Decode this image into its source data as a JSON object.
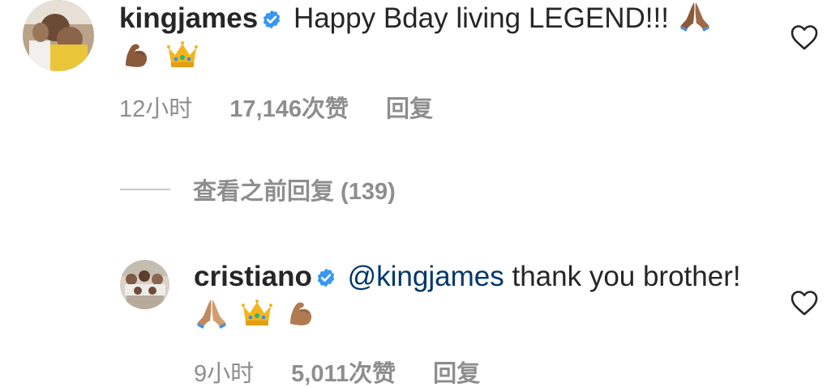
{
  "comments": [
    {
      "username": "kingjames",
      "mention": "",
      "text": "Happy Bday living LEGEND!!!",
      "emojis": [
        "folded-hands-emoji",
        "flexed-biceps-emoji",
        "crown-emoji"
      ],
      "time": "12小时",
      "likes": "17,146次赞",
      "reply_label": "回复"
    },
    {
      "username": "cristiano",
      "mention": "@kingjames",
      "text": "thank you brother!",
      "emojis": [
        "folded-hands-emoji",
        "crown-emoji",
        "flexed-biceps-emoji"
      ],
      "time": "9小时",
      "likes": "5,011次赞",
      "reply_label": "回复"
    }
  ],
  "view_replies": "查看之前回复 (139)",
  "colors": {
    "verified": "#3897f0",
    "meta_text": "#8e8e8e",
    "mention": "#00376b"
  }
}
